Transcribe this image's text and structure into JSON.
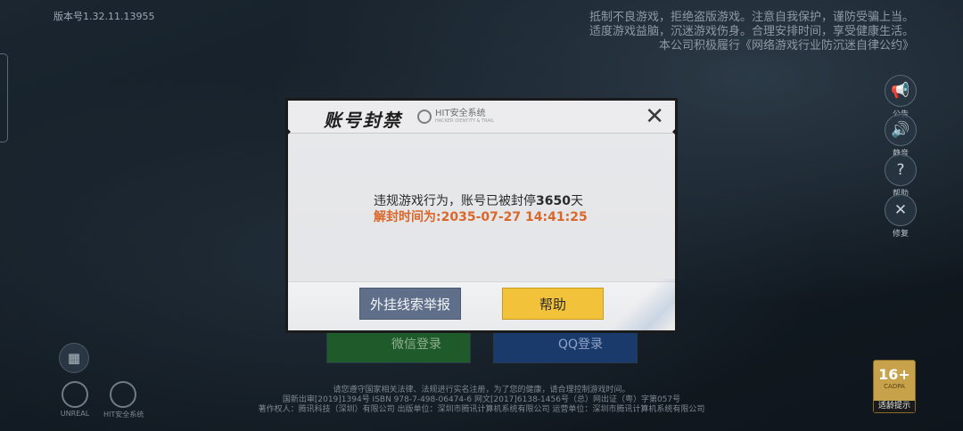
{
  "version": "版本号1.32.11.13955",
  "notice": [
    "抵制不良游戏，拒绝盗版游戏。注意自我保护，谨防受骗上当。",
    "适度游戏益脑，沉迷游戏伤身。合理安排时间，享受健康生活。",
    "本公司积极履行《网络游戏行业防沉迷自律公约》"
  ],
  "side_buttons": [
    {
      "icon": "announcement-icon",
      "glyph": "📢",
      "label": "公告"
    },
    {
      "icon": "volume-icon",
      "glyph": "🔊",
      "label": "静音"
    },
    {
      "icon": "help-icon",
      "glyph": "?",
      "label": "帮助"
    },
    {
      "icon": "repair-icon",
      "glyph": "✕",
      "label": "修复"
    }
  ],
  "login": {
    "wechat": "微信登录",
    "qq": "QQ登录"
  },
  "logos": {
    "unreal": "UNREAL",
    "hit": "HIT安全系统"
  },
  "footer": [
    "请您遵守国家相关法律、法规进行实名注册，为了您的健康，请合理控制游戏时间。",
    "国新出审[2019]1394号  ISBN 978-7-498-06474-6  网文[2017]6138-1456号（总）网出证（粤）字第057号",
    "著作权人：腾讯科技（深圳）有限公司   出版单位：深圳市腾讯计算机系统有限公司   运营单位：深圳市腾讯计算机系统有限公司"
  ],
  "age_badge": {
    "rating": "16+",
    "sub": "CADPA",
    "label": "适龄提示"
  },
  "dialog": {
    "title": "账号封禁",
    "hit_text": "HIT安全系统",
    "hit_sub": "HACKER IDENTITY & TRAIL",
    "close_glyph": "✕",
    "line1_prefix": "违规游戏行为，账号已被封停",
    "days": "3650",
    "line1_suffix": "天",
    "unban_label": "解封时间为:",
    "unban_time": "2035-07-27 14:41:25",
    "report_button": "外挂线索举报",
    "help_button": "帮助"
  },
  "colors": {
    "accent_orange": "#d9672a",
    "help_yellow": "#f2c23a",
    "report_blue": "#5f6f8a"
  }
}
